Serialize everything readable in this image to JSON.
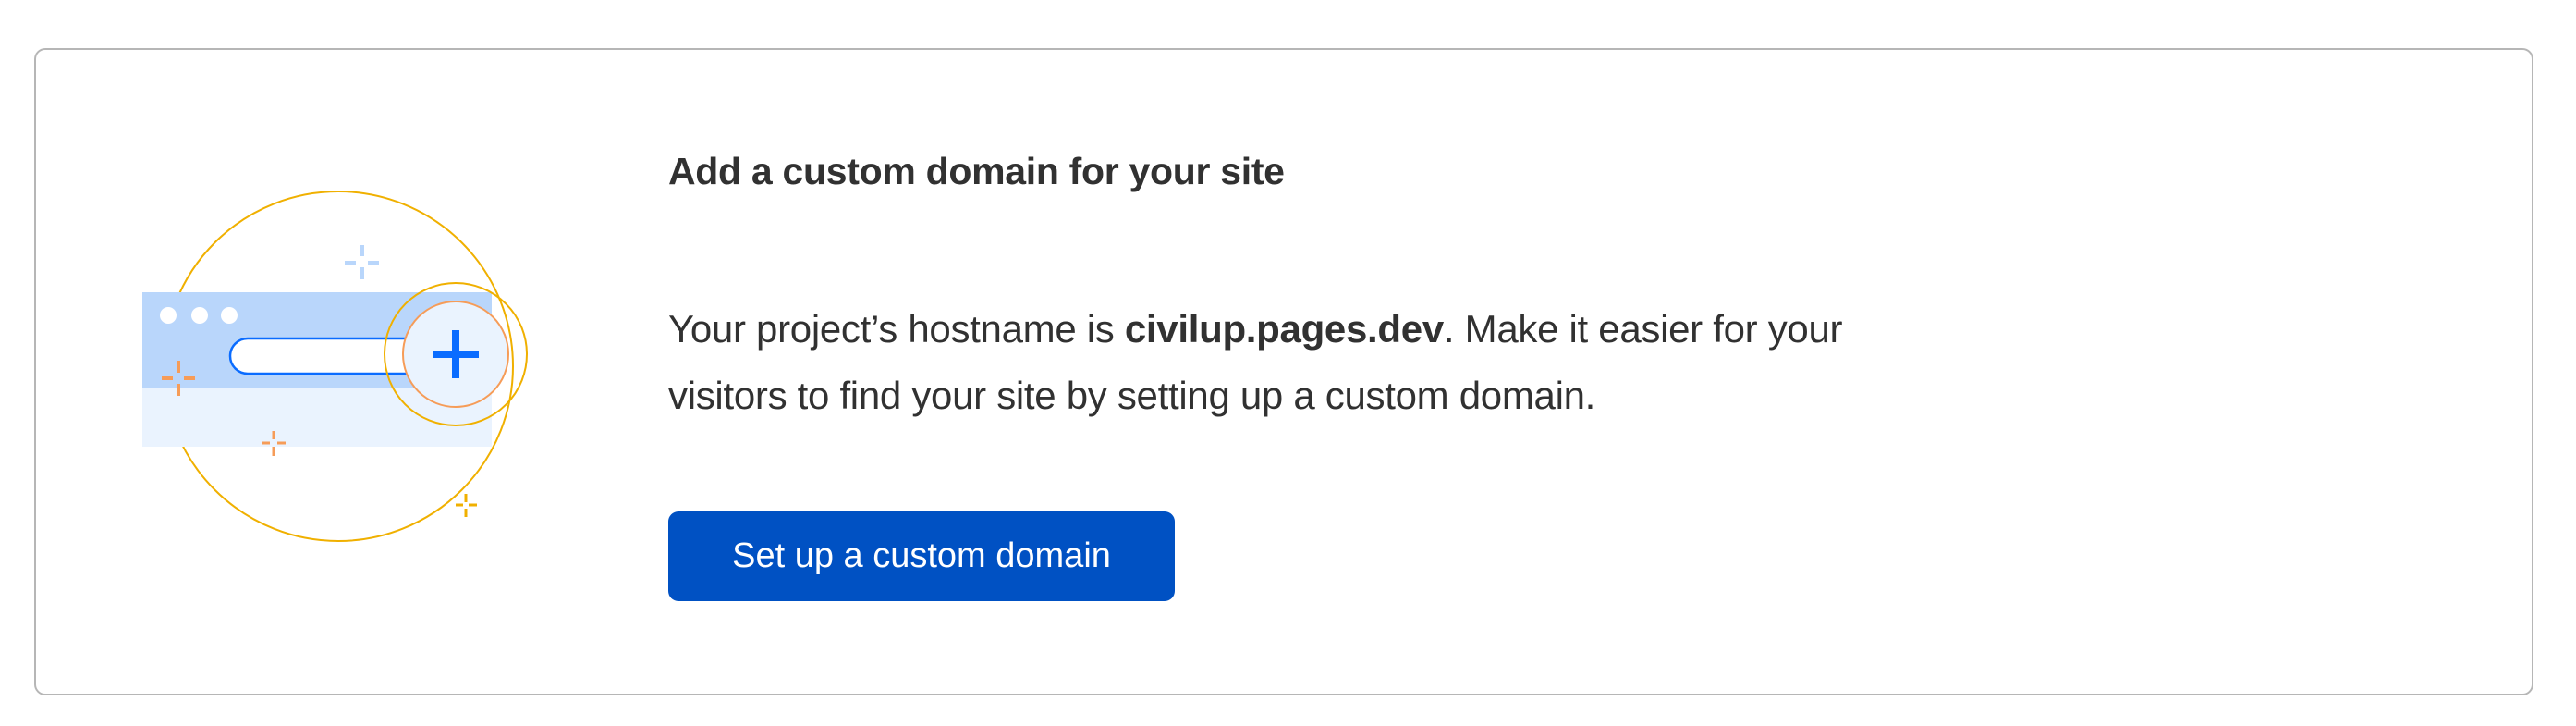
{
  "card": {
    "title": "Add a custom domain for your site",
    "description": {
      "prefix": "Your project’s hostname is ",
      "hostname": "civilup.pages.dev",
      "suffix": ". Make it easier for your",
      "line2": "visitors to find your site by setting up a custom domain."
    },
    "button_label": "Set up a custom domain"
  },
  "colors": {
    "button": "#0051c3",
    "banner_dark": "#b9d6fb",
    "banner_light": "#eaf3fe",
    "accent_blue": "#0a6cff",
    "circle_yellow": "#f0b000",
    "circle_orange": "#f69c58"
  },
  "illustration": {
    "icon": "add-domain-browser-plus-illustration"
  }
}
